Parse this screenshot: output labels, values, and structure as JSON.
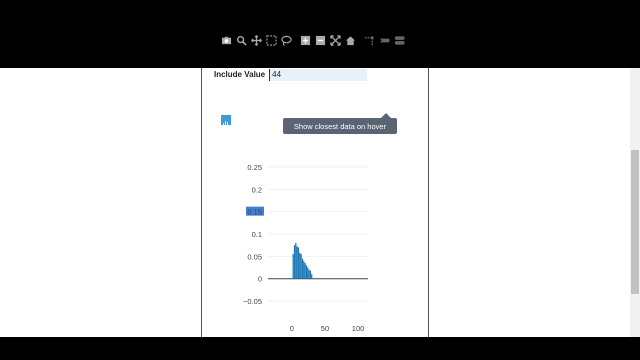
{
  "form": {
    "include_label": "Include Value",
    "include_value": "44"
  },
  "modebar": {
    "buttons": [
      {
        "name": "camera-icon"
      },
      {
        "name": "zoom-icon"
      },
      {
        "name": "pan-icon"
      },
      {
        "name": "box-select-icon"
      },
      {
        "name": "lasso-icon"
      },
      {
        "name": "zoom-in-icon"
      },
      {
        "name": "zoom-out-icon"
      },
      {
        "name": "autoscale-icon"
      },
      {
        "name": "home-icon"
      },
      {
        "name": "spike-lines-icon"
      },
      {
        "name": "hover-closest-icon"
      },
      {
        "name": "hover-compare-icon"
      }
    ],
    "tooltip": "Show closest data on hover",
    "logo": "plotly-logo-icon"
  },
  "chart_data": {
    "type": "bar",
    "x": [
      2,
      4,
      6,
      8,
      10,
      12,
      14,
      16,
      18,
      20,
      22,
      24,
      26,
      28,
      30
    ],
    "values": [
      0.055,
      0.075,
      0.08,
      0.072,
      0.07,
      0.058,
      0.055,
      0.045,
      0.04,
      0.035,
      0.03,
      0.025,
      0.02,
      0.018,
      0.01
    ],
    "yticks": [
      "0.25",
      "0.2",
      "0.15",
      "0.1",
      "0.05",
      "0",
      "−0.05"
    ],
    "ytick_values": [
      0.25,
      0.2,
      0.15,
      0.1,
      0.05,
      0,
      -0.05
    ],
    "xticks": [
      "0",
      "50",
      "100"
    ],
    "xtick_values": [
      0,
      50,
      100
    ],
    "xlim": [
      -36,
      115
    ],
    "ylim": [
      -0.07,
      0.27
    ],
    "highlighted_tick": "0.15",
    "bar_color": "#1f77b4",
    "highlight_color": "#3f7fd6",
    "grid": true
  }
}
